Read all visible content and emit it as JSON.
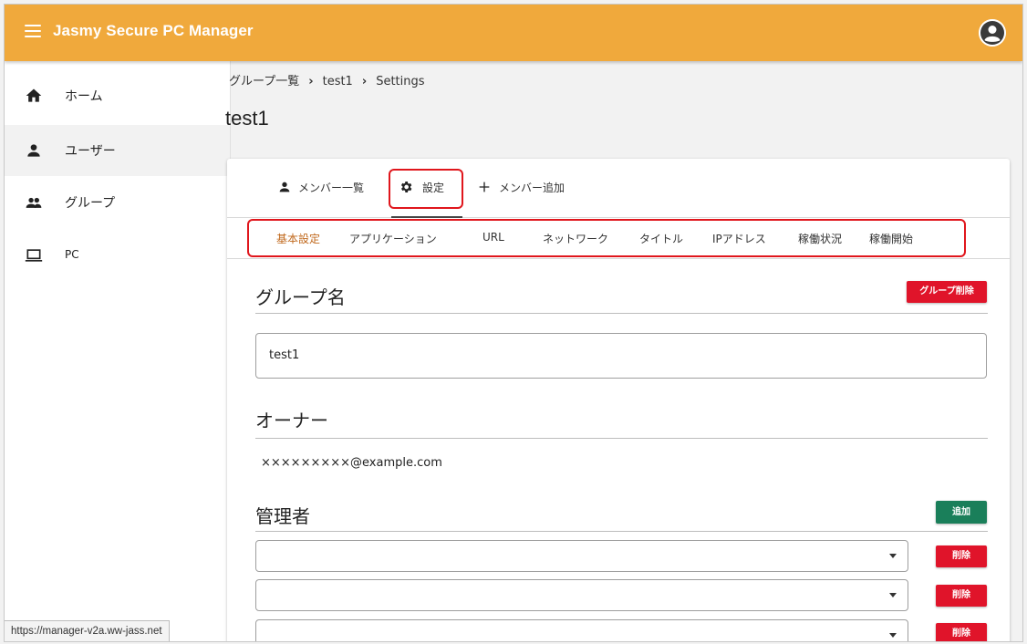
{
  "app": {
    "title": "Jasmy Secure PC Manager"
  },
  "sidebar": {
    "items": [
      {
        "label": "ホーム",
        "icon": "home-icon"
      },
      {
        "label": "ユーザー",
        "icon": "person-icon"
      },
      {
        "label": "グループ",
        "icon": "group-icon"
      },
      {
        "label": "PC",
        "icon": "laptop-icon"
      }
    ]
  },
  "status_bar": {
    "url": "https://manager-v2a.ww-jass.net"
  },
  "breadcrumb": {
    "items": [
      "グループ一覧",
      "test1",
      "Settings"
    ]
  },
  "page": {
    "title": "test1"
  },
  "top_tabs": [
    {
      "label": "メンバー一覧",
      "icon": "person-icon"
    },
    {
      "label": "設定",
      "icon": "gear-icon",
      "active": true
    },
    {
      "label": "メンバー追加",
      "icon": "plus-icon"
    }
  ],
  "sub_tabs": [
    {
      "label": "基本設定",
      "active": true
    },
    {
      "label": "アプリケーション"
    },
    {
      "label": "URL"
    },
    {
      "label": "ネットワーク"
    },
    {
      "label": "タイトル"
    },
    {
      "label": "IPアドレス"
    },
    {
      "label": "稼働状況"
    },
    {
      "label": "稼働開始"
    }
  ],
  "group_name": {
    "heading": "グループ名",
    "delete_button": "グループ削除",
    "value": "test1"
  },
  "owner": {
    "heading": "オーナー",
    "email": "×××××××××@example.com"
  },
  "admins": {
    "heading": "管理者",
    "add_button": "追加",
    "delete_label": "削除",
    "rows": [
      "",
      "",
      ""
    ]
  },
  "colors": {
    "appbar": "#f0a93c",
    "accent_tab": "#c0681c",
    "danger": "#e0142a",
    "success": "#1a7f5a",
    "highlight": "#e0161c"
  }
}
